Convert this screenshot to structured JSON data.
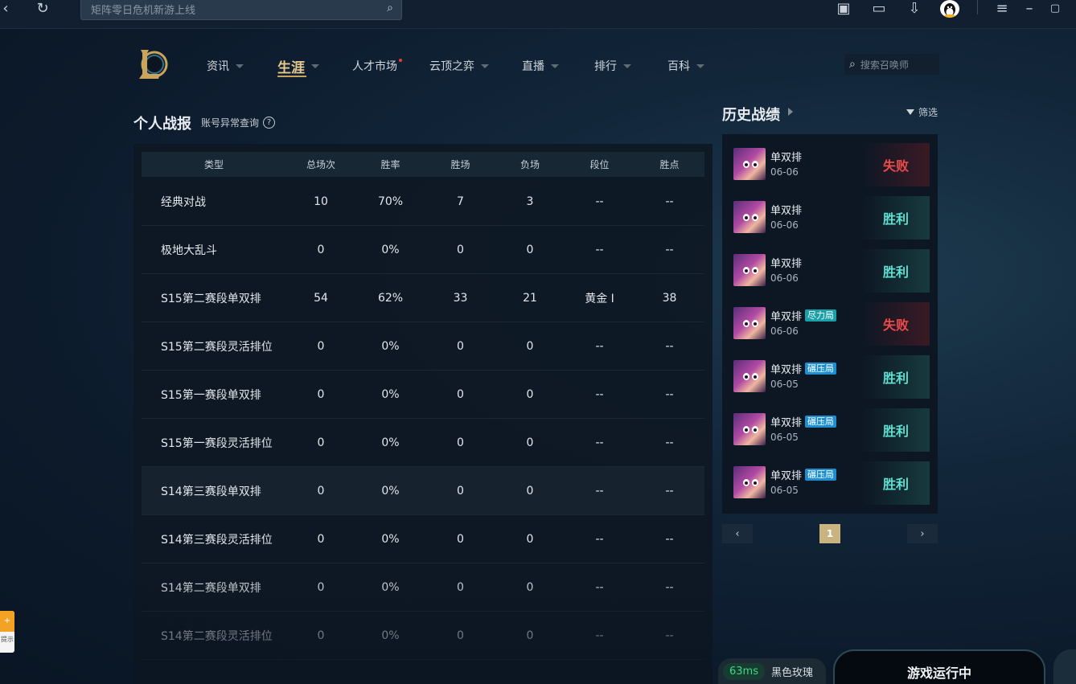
{
  "topbar": {
    "search_placeholder": "矩阵零日危机新游上线"
  },
  "nav": {
    "items": [
      {
        "label": "资讯"
      },
      {
        "label": "生涯"
      },
      {
        "label": "人才市场"
      },
      {
        "label": "云顶之弈"
      },
      {
        "label": "直播"
      },
      {
        "label": "排行"
      },
      {
        "label": "百科"
      }
    ],
    "active": "生涯",
    "search_placeholder": "搜索召唤师"
  },
  "report": {
    "title": "个人战报",
    "abnormal_link": "账号异常查询",
    "columns": [
      "类型",
      "总场次",
      "胜率",
      "胜场",
      "负场",
      "段位",
      "胜点"
    ],
    "rows": [
      {
        "type": "经典对战",
        "total": "10",
        "winrate": "70%",
        "wins": "7",
        "losses": "3",
        "rank": "--",
        "lp": "--"
      },
      {
        "type": "极地大乱斗",
        "total": "0",
        "winrate": "0%",
        "wins": "0",
        "losses": "0",
        "rank": "--",
        "lp": "--"
      },
      {
        "type": "S15第二赛段单双排",
        "total": "54",
        "winrate": "62%",
        "wins": "33",
        "losses": "21",
        "rank": "黄金 I",
        "lp": "38"
      },
      {
        "type": "S15第二赛段灵活排位",
        "total": "0",
        "winrate": "0%",
        "wins": "0",
        "losses": "0",
        "rank": "--",
        "lp": "--"
      },
      {
        "type": "S15第一赛段单双排",
        "total": "0",
        "winrate": "0%",
        "wins": "0",
        "losses": "0",
        "rank": "--",
        "lp": "--"
      },
      {
        "type": "S15第一赛段灵活排位",
        "total": "0",
        "winrate": "0%",
        "wins": "0",
        "losses": "0",
        "rank": "--",
        "lp": "--"
      },
      {
        "type": "S14第三赛段单双排",
        "total": "0",
        "winrate": "0%",
        "wins": "0",
        "losses": "0",
        "rank": "--",
        "lp": "--"
      },
      {
        "type": "S14第三赛段灵活排位",
        "total": "0",
        "winrate": "0%",
        "wins": "0",
        "losses": "0",
        "rank": "--",
        "lp": "--"
      },
      {
        "type": "S14第二赛段单双排",
        "total": "0",
        "winrate": "0%",
        "wins": "0",
        "losses": "0",
        "rank": "--",
        "lp": "--"
      },
      {
        "type": "S14第二赛段灵活排位",
        "total": "0",
        "winrate": "0%",
        "wins": "0",
        "losses": "0",
        "rank": "--",
        "lp": "--"
      }
    ]
  },
  "history": {
    "title": "历史战绩",
    "filter_label": "筛选",
    "matches": [
      {
        "mode": "单双排",
        "tag": "",
        "date": "06-06",
        "result": "失败",
        "outcome": "lose"
      },
      {
        "mode": "单双排",
        "tag": "",
        "date": "06-06",
        "result": "胜利",
        "outcome": "win"
      },
      {
        "mode": "单双排",
        "tag": "",
        "date": "06-06",
        "result": "胜利",
        "outcome": "win"
      },
      {
        "mode": "单双排",
        "tag": "尽力局",
        "date": "06-06",
        "result": "失败",
        "outcome": "lose"
      },
      {
        "mode": "单双排",
        "tag": "碾压局",
        "date": "06-05",
        "result": "胜利",
        "outcome": "win"
      },
      {
        "mode": "单双排",
        "tag": "碾压局",
        "date": "06-05",
        "result": "胜利",
        "outcome": "win"
      },
      {
        "mode": "单双排",
        "tag": "碾压局",
        "date": "06-05",
        "result": "胜利",
        "outcome": "win"
      }
    ],
    "current_page": "1"
  },
  "status": {
    "ping": "63ms",
    "server": "黑色玫瑰",
    "game_state": "游戏运行中"
  },
  "side_widget": {
    "label": "提示"
  },
  "colors": {
    "accent_gold": "#c8a35a",
    "win": "#5fe0d0",
    "lose": "#ec4b4b",
    "ping_good": "#3fd88a"
  }
}
